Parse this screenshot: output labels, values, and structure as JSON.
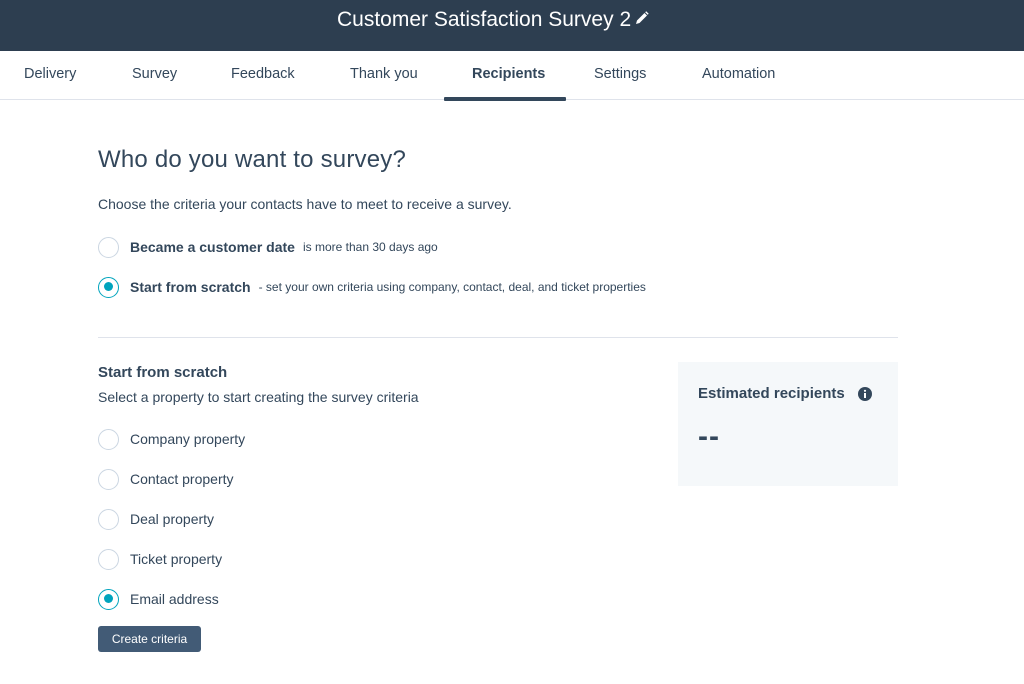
{
  "header": {
    "title": "Customer Satisfaction Survey 2",
    "edit_icon": "pencil-icon"
  },
  "tabs": [
    {
      "label": "Delivery",
      "active": false
    },
    {
      "label": "Survey",
      "active": false
    },
    {
      "label": "Feedback",
      "active": false
    },
    {
      "label": "Thank you",
      "active": false
    },
    {
      "label": "Recipients",
      "active": true
    },
    {
      "label": "Settings",
      "active": false
    },
    {
      "label": "Automation",
      "active": false
    }
  ],
  "main": {
    "heading": "Who do you want to survey?",
    "description": "Choose the criteria your contacts have to meet to receive a survey.",
    "criteria_options": [
      {
        "label": "Became a customer date",
        "note": "is more than 30 days ago",
        "checked": false
      },
      {
        "label": "Start from scratch",
        "note": "- set your own criteria using company, contact, deal, and ticket properties",
        "checked": true
      }
    ]
  },
  "scratch": {
    "heading": "Start from scratch",
    "subheading": "Select a property to start creating the survey criteria",
    "properties": [
      {
        "label": "Company property",
        "checked": false
      },
      {
        "label": "Contact property",
        "checked": false
      },
      {
        "label": "Deal property",
        "checked": false
      },
      {
        "label": "Ticket property",
        "checked": false
      },
      {
        "label": "Email address",
        "checked": true
      }
    ],
    "create_button": "Create criteria"
  },
  "estimate": {
    "title": "Estimated recipients",
    "info_icon": "info-icon",
    "value": "--"
  },
  "colors": {
    "header_bg": "#2d3e50",
    "accent": "#00a4bd",
    "text": "#33475b",
    "button_bg": "#425b76",
    "card_bg": "#f5f8fa"
  }
}
